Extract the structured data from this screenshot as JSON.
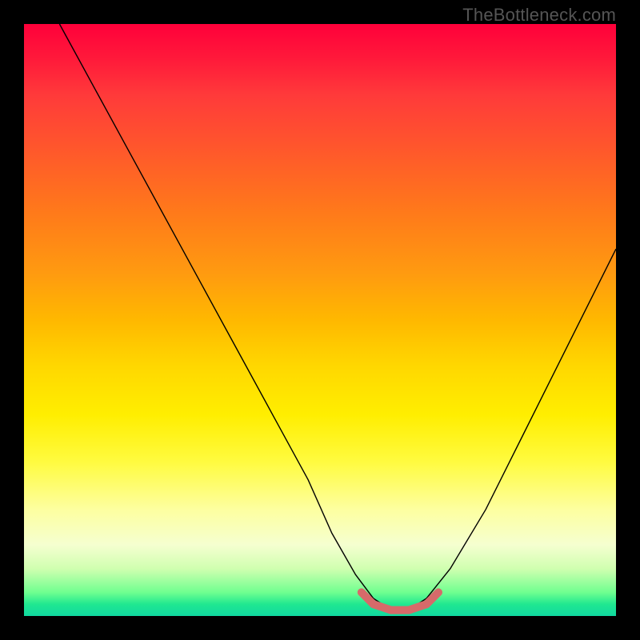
{
  "watermark": "TheBottleneck.com",
  "chart_data": {
    "type": "line",
    "title": "",
    "xlabel": "",
    "ylabel": "",
    "xlim": [
      0,
      100
    ],
    "ylim": [
      0,
      100
    ],
    "series": [
      {
        "name": "bottleneck-curve",
        "x": [
          6,
          12,
          18,
          24,
          30,
          36,
          42,
          48,
          52,
          56,
          59,
          62,
          65,
          68,
          72,
          78,
          84,
          90,
          96,
          100
        ],
        "y": [
          100,
          89,
          78,
          67,
          56,
          45,
          34,
          23,
          14,
          7,
          3,
          1,
          1,
          3,
          8,
          18,
          30,
          42,
          54,
          62
        ]
      }
    ],
    "annotations": [
      {
        "name": "sweet-spot",
        "x": [
          57,
          59,
          62,
          65,
          68,
          70
        ],
        "y": [
          4,
          2,
          1,
          1,
          2,
          4
        ]
      }
    ]
  }
}
